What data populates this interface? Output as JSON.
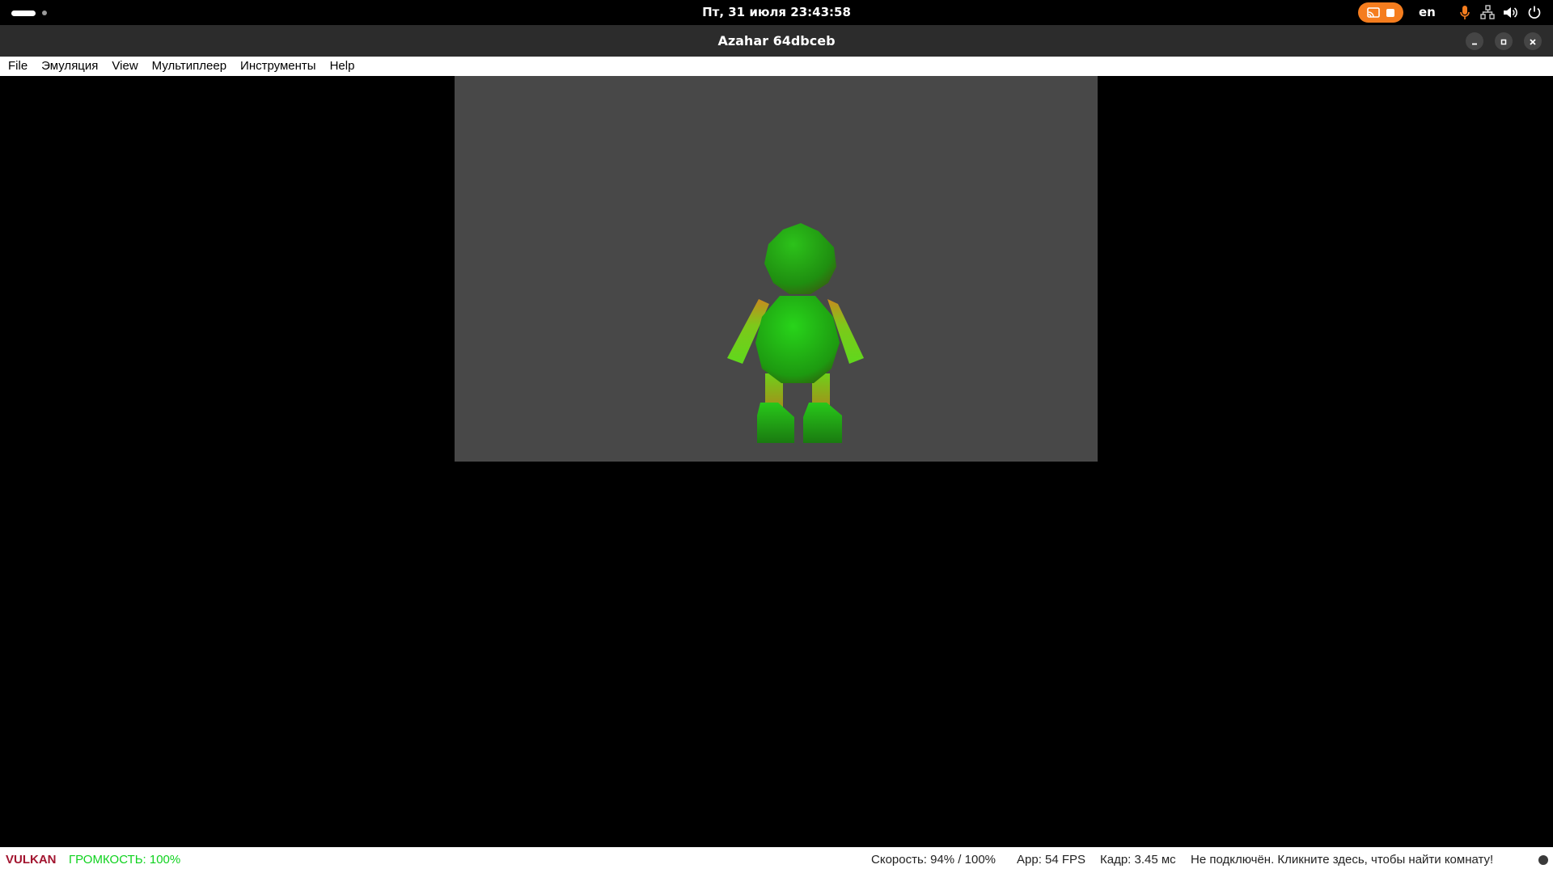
{
  "topbar": {
    "datetime": "Пт, 31 июля  23:43:58",
    "language": "en",
    "recording_color": "#f57d1e",
    "icons": [
      "screencast-icon",
      "stop-icon",
      "microphone-icon",
      "network-icon",
      "volume-icon",
      "power-icon"
    ]
  },
  "window": {
    "title": "Azahar 64dbceb"
  },
  "menu": {
    "items": [
      "File",
      "Эмуляция",
      "View",
      "Мультиплеер",
      "Инструменты",
      "Help"
    ]
  },
  "status": {
    "graphics_api": "VULKAN",
    "volume": "ГРОМКОСТЬ: 100%",
    "speed": "Скорость: 94% / 100%",
    "fps": "App: 54 FPS",
    "frame_time": "Кадр: 3.45 мс",
    "network": "Не подключён. Кликните здесь, чтобы найти комнату!",
    "api_color": "#a2142f",
    "volume_color": "#0fd21e"
  },
  "colors": {
    "screen_bg": "#484848",
    "character_green": "#22b714"
  }
}
